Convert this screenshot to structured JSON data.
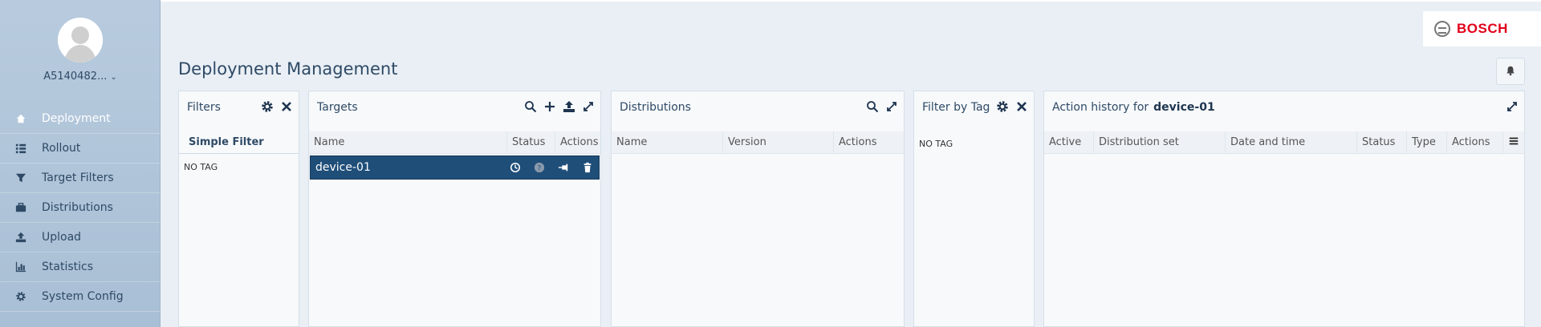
{
  "user": {
    "name": "A5140482...",
    "chevron": "chevron-down-icon"
  },
  "nav": [
    {
      "label": "Deployment",
      "icon": "house-icon",
      "active": true
    },
    {
      "label": "Rollout",
      "icon": "list-icon"
    },
    {
      "label": "Target Filters",
      "icon": "funnel-icon"
    },
    {
      "label": "Distributions",
      "icon": "briefcase-icon"
    },
    {
      "label": "Upload",
      "icon": "upload-icon"
    },
    {
      "label": "Statistics",
      "icon": "bar-chart-icon"
    },
    {
      "label": "System Config",
      "icon": "gear-icon"
    }
  ],
  "brand": {
    "logo_text": "BOSCH",
    "color": "#e2001a"
  },
  "page": {
    "title": "Deployment Management"
  },
  "filters": {
    "title": "Filters",
    "simple_filter": "Simple Filter",
    "no_tag": "NO TAG"
  },
  "targets": {
    "title": "Targets",
    "columns": [
      "Name",
      "Status",
      "Actions"
    ],
    "rows": [
      {
        "name": "device-01"
      }
    ]
  },
  "distributions": {
    "title": "Distributions",
    "columns": [
      "Name",
      "Version",
      "Actions"
    ]
  },
  "filter_by_tag": {
    "title": "Filter by Tag",
    "no_tag": "NO TAG"
  },
  "action_history": {
    "title": "Action history for",
    "target": "device-01",
    "columns": [
      "Active",
      "Distribution set",
      "Date and time",
      "Status",
      "Type",
      "Actions"
    ]
  },
  "colors": {
    "accent": "#1f4e79",
    "sidebar": "#b8cbde",
    "title": "#2f4a66"
  }
}
